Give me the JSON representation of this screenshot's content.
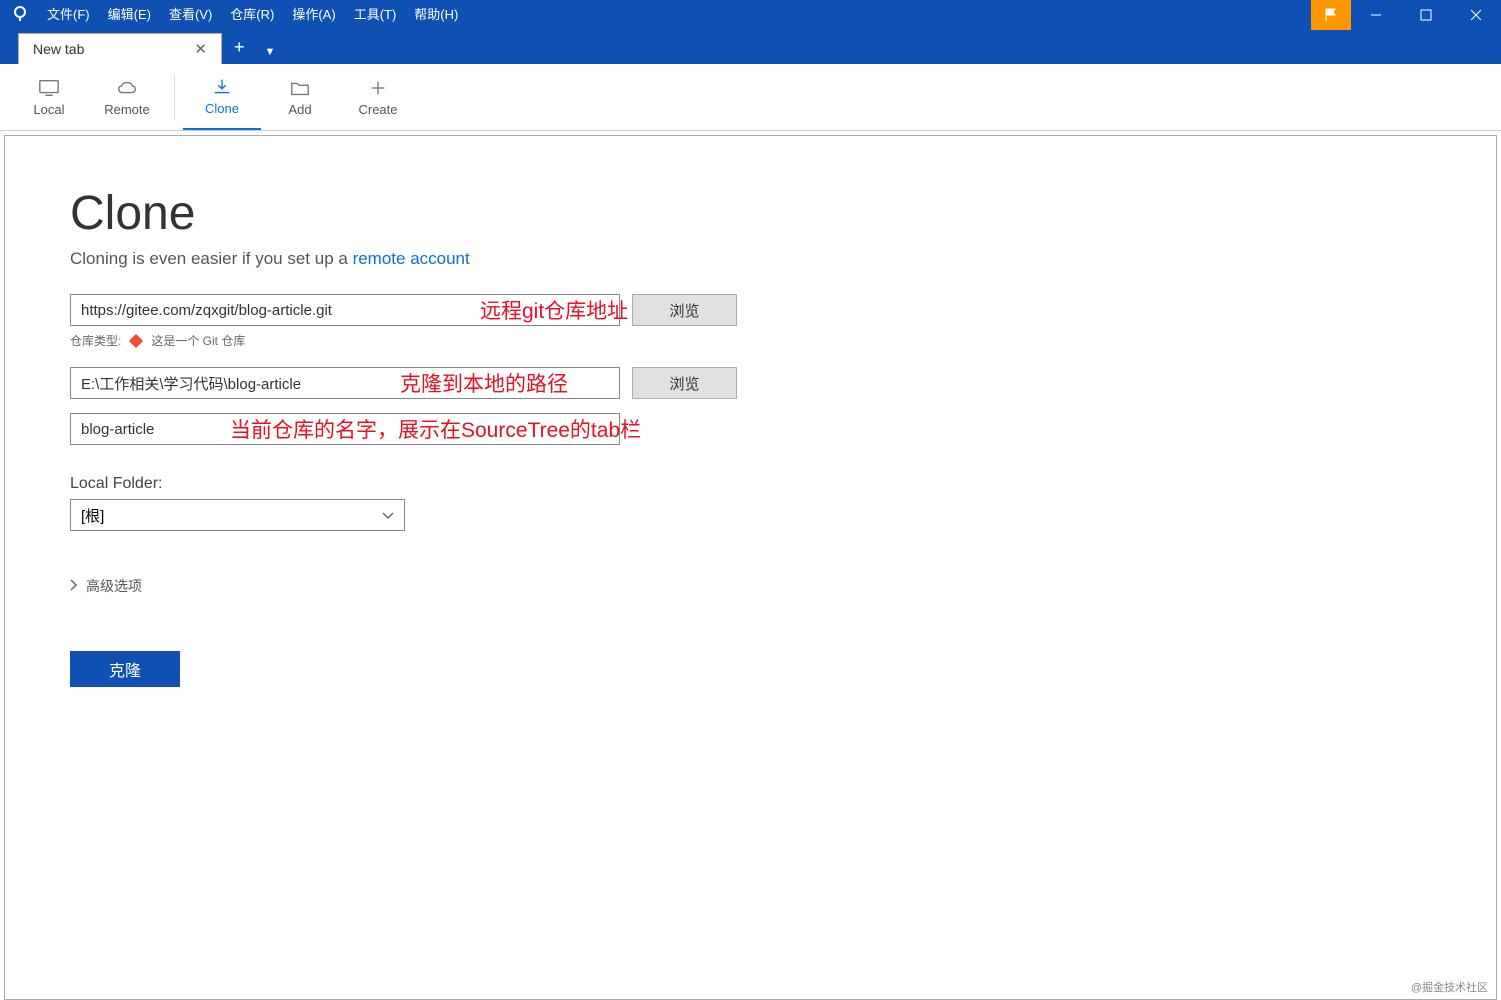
{
  "menu": {
    "file": "文件(F)",
    "edit": "编辑(E)",
    "view": "查看(V)",
    "repo": "仓库(R)",
    "action": "操作(A)",
    "tools": "工具(T)",
    "help": "帮助(H)"
  },
  "tabs": {
    "current": "New tab"
  },
  "toolbar": {
    "local": "Local",
    "remote": "Remote",
    "clone": "Clone",
    "add": "Add",
    "create": "Create"
  },
  "page": {
    "title": "Clone",
    "subtitle_pre": "Cloning is even easier if you set up a ",
    "subtitle_link": "remote account"
  },
  "form": {
    "repo_url": "https://gitee.com/zqxgit/blog-article.git",
    "local_path": "E:\\工作相关\\学习代码\\blog-article",
    "repo_name": "blog-article",
    "browse": "浏览",
    "repo_type_label": "仓库类型:",
    "repo_type_text": "这是一个 Git 仓库",
    "local_folder_label": "Local Folder:",
    "local_folder_value": "[根]",
    "advanced": "高级选项",
    "clone_btn": "克隆"
  },
  "annotations": {
    "url": "远程git仓库地址",
    "path": "克隆到本地的路径",
    "name": "当前仓库的名字，展示在SourceTree的tab栏"
  },
  "watermark": "@掘金技术社区"
}
